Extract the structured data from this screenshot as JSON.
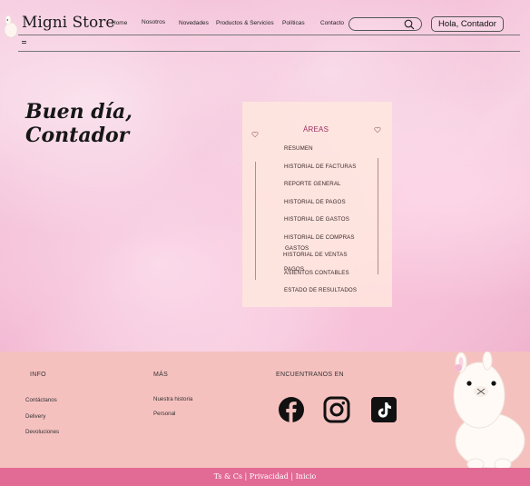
{
  "header": {
    "brand": "Migni Store",
    "nav": [
      "Home",
      "Nosotros",
      "Novedades",
      "Productos & Servicios",
      "Políticas",
      "Contacto"
    ],
    "search": {
      "placeholder": ""
    },
    "login_label": "Hola, Contador"
  },
  "greeting": {
    "line1": "Buen día,",
    "line2": "Contador"
  },
  "areas": {
    "title": "ÁREAS",
    "items": [
      "RESUMEN",
      "HISTORIAL DE FACTURAS",
      "REPORTE GENERAL",
      "HISTORIAL DE PAGOS",
      "HISTORIAL DE GASTOS",
      "HISTORIAL DE COMPRAS",
      "GASTOS",
      "HISTORIAL DE VENTAS",
      "PAGOS",
      "ASIENTOS CONTABLES",
      "ESTADO DE RESULTADOS"
    ]
  },
  "footer": {
    "info_heading": "INFO",
    "info_links": [
      "Contáctanos",
      "Delivery",
      "Devoluciones"
    ],
    "mas_heading": "MÁS",
    "mas_links": [
      "Nuestra historia",
      "Personal"
    ],
    "social_heading": "ENCUENTRANOS EN",
    "social_icons": [
      "facebook-icon",
      "instagram-icon",
      "tiktok-icon"
    ]
  },
  "bottom_bar": {
    "terms": "Ts & Cs",
    "privacy": "Privacidad",
    "home": "Inicio",
    "separator": "|"
  },
  "colors": {
    "accent_title": "#9b2f62",
    "footer_bg": "#f5c1bf",
    "bottom_bar_bg": "#e26b95",
    "panel_bg": "#ffe8de"
  }
}
